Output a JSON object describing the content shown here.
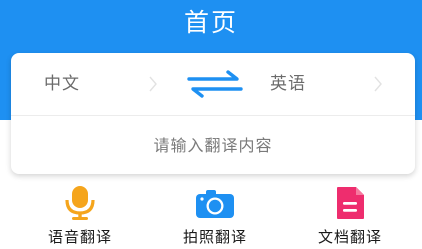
{
  "header": {
    "title": "首页"
  },
  "translator": {
    "source_lang": "中文",
    "target_lang": "英语",
    "swap_icon": "swap-arrows-icon",
    "input_placeholder": "请输入翻译内容"
  },
  "actions": [
    {
      "label": "语音翻译",
      "icon": "microphone-icon",
      "color": "#f5a51c"
    },
    {
      "label": "拍照翻译",
      "icon": "camera-icon",
      "color": "#1e90f2"
    },
    {
      "label": "文档翻译",
      "icon": "document-icon",
      "color": "#ee2d6e"
    }
  ],
  "colors": {
    "header_bg": "#1e90f2",
    "swap_arrows": "#1e90f2",
    "text_muted": "#6b6b6b"
  }
}
